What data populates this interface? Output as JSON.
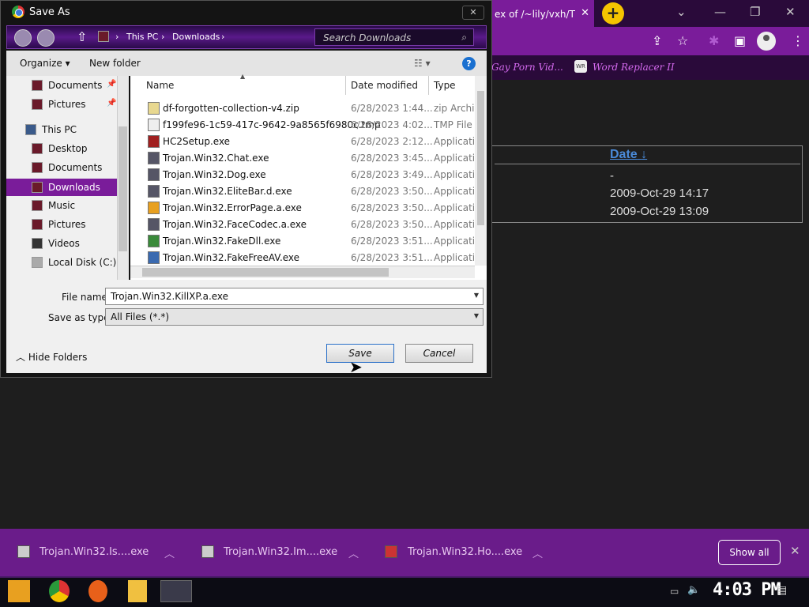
{
  "browser": {
    "tab_title": "ex of /~lily/vxh/T",
    "tab_close": "✕",
    "new_tab": "+",
    "bookmarks": [
      {
        "label": "Gay Porn Vid..."
      },
      {
        "label": "Word Replacer II",
        "icon_text": "WR"
      }
    ]
  },
  "page": {
    "date_header": "Date",
    "sort_glyph": "↓",
    "cells": [
      "-",
      "2009-Oct-29 14:17",
      "2009-Oct-29 13:09"
    ]
  },
  "dialog": {
    "title": "Save As",
    "close": "✕",
    "breadcrumb": [
      "This PC",
      "Downloads"
    ],
    "search_placeholder": "Search Downloads",
    "organize": "Organize",
    "new_folder": "New folder",
    "help": "?",
    "nav_items": [
      {
        "label": "Documents",
        "pinned": true
      },
      {
        "label": "Pictures",
        "pinned": true
      },
      {
        "label": "This PC"
      },
      {
        "label": "Desktop"
      },
      {
        "label": "Documents"
      },
      {
        "label": "Downloads",
        "selected": true
      },
      {
        "label": "Music"
      },
      {
        "label": "Pictures"
      },
      {
        "label": "Videos"
      },
      {
        "label": "Local Disk (C:)"
      }
    ],
    "columns": {
      "name": "Name",
      "date": "Date modified",
      "type": "Type"
    },
    "files": [
      {
        "name": "df-forgotten-collection-v4.zip",
        "date": "6/28/2023 1:44...",
        "type": "zip Archive"
      },
      {
        "name": "f199fe96-1c59-417c-9642-9a8565f6980c.tmp",
        "date": "6/28/2023 4:02...",
        "type": "TMP File"
      },
      {
        "name": "HC2Setup.exe",
        "date": "6/28/2023 2:12...",
        "type": "Application"
      },
      {
        "name": "Trojan.Win32.Chat.exe",
        "date": "6/28/2023 3:45...",
        "type": "Application"
      },
      {
        "name": "Trojan.Win32.Dog.exe",
        "date": "6/28/2023 3:49...",
        "type": "Application"
      },
      {
        "name": "Trojan.Win32.EliteBar.d.exe",
        "date": "6/28/2023 3:50...",
        "type": "Application"
      },
      {
        "name": "Trojan.Win32.ErrorPage.a.exe",
        "date": "6/28/2023 3:50...",
        "type": "Application"
      },
      {
        "name": "Trojan.Win32.FaceCodec.a.exe",
        "date": "6/28/2023 3:50...",
        "type": "Application"
      },
      {
        "name": "Trojan.Win32.FakeDll.exe",
        "date": "6/28/2023 3:51...",
        "type": "Application"
      },
      {
        "name": "Trojan.Win32.FakeFreeAV.exe",
        "date": "6/28/2023 3:51...",
        "type": "Application"
      }
    ],
    "file_name_label": "File name:",
    "file_name_value": "Trojan.Win32.KillXP.a.exe",
    "save_type_label": "Save as type:",
    "save_type_value": "All Files (*.*)",
    "hide_folders": "Hide Folders",
    "save": "Save",
    "cancel": "Cancel"
  },
  "downloads": {
    "items": [
      "Trojan.Win32.Is....exe",
      "Trojan.Win32.Im....exe",
      "Trojan.Win32.Ho....exe"
    ],
    "show_all": "Show all",
    "close": "✕"
  },
  "taskbar": {
    "clock": "4:03 PM"
  },
  "colors": {
    "accent": "#7a1c9a",
    "dark": "#1e1e1e"
  }
}
